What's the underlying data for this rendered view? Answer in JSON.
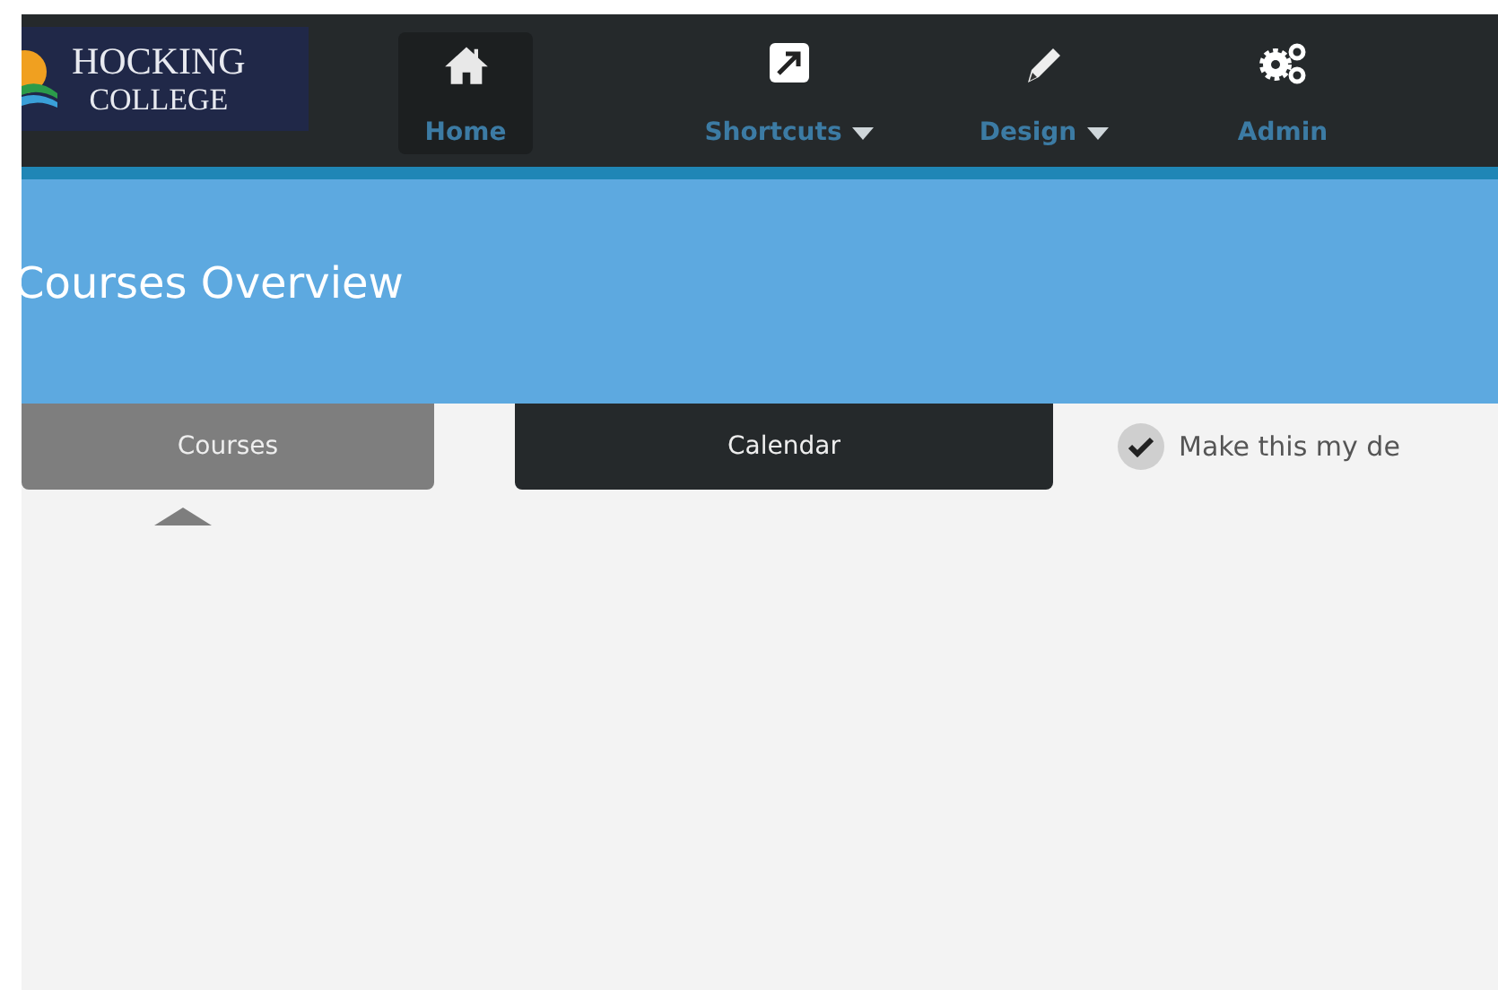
{
  "logo": {
    "line_1": "HOCKING",
    "line_2": "COLLEGE"
  },
  "nav": [
    {
      "label": "Home",
      "kind": "home",
      "selected": true,
      "dropdown": false
    },
    {
      "label": "Shortcuts",
      "kind": "shortcut",
      "selected": false,
      "dropdown": true
    },
    {
      "label": "Design",
      "kind": "pencil",
      "selected": false,
      "dropdown": true
    },
    {
      "label": "Admin",
      "kind": "gears",
      "selected": false,
      "dropdown": false
    }
  ],
  "banner": {
    "title": "Courses Overview"
  },
  "tabs": [
    {
      "label": "Courses",
      "selected": true
    },
    {
      "label": "Calendar",
      "selected": false
    }
  ],
  "default_option": {
    "label": "Make this my de",
    "checked": true
  }
}
